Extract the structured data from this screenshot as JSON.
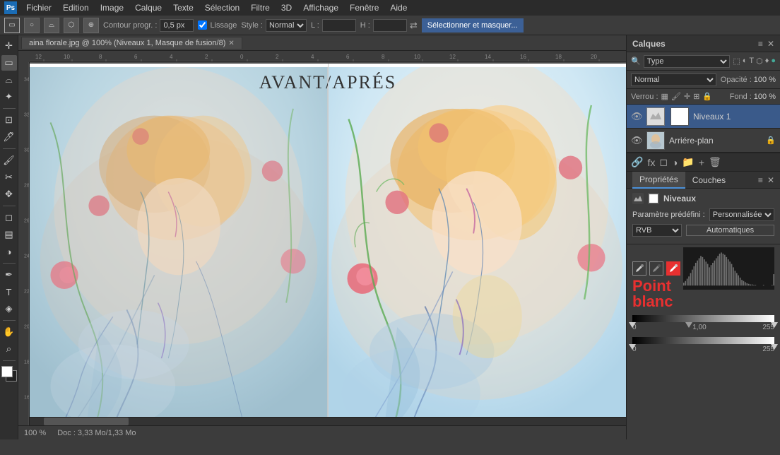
{
  "app": {
    "title": "Adobe Photoshop",
    "logo": "Ps"
  },
  "menubar": {
    "items": [
      "Fichier",
      "Edition",
      "Image",
      "Calque",
      "Texte",
      "Sélection",
      "Filtre",
      "3D",
      "Affichage",
      "Fenêtre",
      "Aide"
    ]
  },
  "optionsbar": {
    "contour_label": "Contour progr. :",
    "contour_value": "0,5 px",
    "lissage_label": "Lissage",
    "style_label": "Style :",
    "style_value": "Normal",
    "l_label": "L :",
    "h_label": "H :",
    "select_mask_btn": "Sélectionner et masquer..."
  },
  "canvas": {
    "tab_name": "aina florale.jpg @ 100% (Niveaux 1, Masque de fusion/8)",
    "title": "AVANT/APRÉS",
    "zoom": "100 %",
    "doc_info": "Doc : 3,33 Mo/1,33 Mo"
  },
  "layers_panel": {
    "title": "Calques",
    "search_placeholder": "Type",
    "blend_mode": "Normal",
    "opacity_label": "Opacité :",
    "opacity_value": "100 %",
    "lock_label": "Verrou :",
    "fill_label": "Fond :",
    "fill_value": "100 %",
    "layers": [
      {
        "name": "Niveaux 1",
        "visible": true,
        "selected": true,
        "has_mask": true
      },
      {
        "name": "Arriére-plan",
        "visible": true,
        "selected": false,
        "locked": true
      }
    ]
  },
  "properties_panel": {
    "tabs": [
      "Propriétés",
      "Couches"
    ],
    "active_tab": "Propriétés",
    "section_title": "Niveaux",
    "preset_label": "Paramètre prédéfini :",
    "preset_value": "Personnalisée",
    "channel_value": "RVB",
    "auto_label": "Automatiques",
    "point_blanc": "Point",
    "point_blanc2": "blanc",
    "histogram": {
      "min": "0",
      "mid": "1,00",
      "max": "255"
    }
  },
  "icons": {
    "eye": "👁",
    "lock": "🔒",
    "search": "🔍",
    "plus": "+",
    "minus": "−",
    "folder": "📁",
    "trash": "🗑",
    "fx": "fx",
    "mask": "◻"
  }
}
